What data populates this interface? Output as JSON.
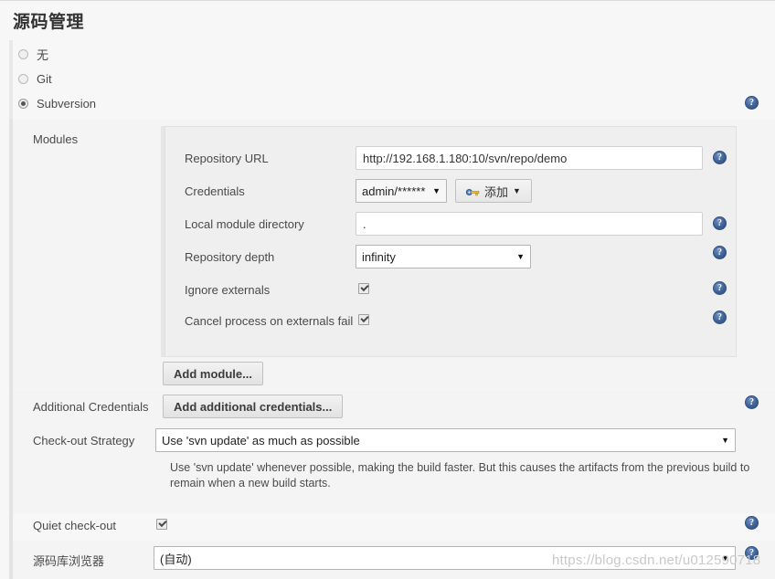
{
  "page": {
    "title": "源码管理",
    "watermark": "https://blog.csdn.net/u012590718"
  },
  "scm_options": [
    {
      "label": "无",
      "selected": false
    },
    {
      "label": "Git",
      "selected": false
    },
    {
      "label": "Subversion",
      "selected": true
    }
  ],
  "modules": {
    "section_label": "Modules",
    "add_module_label": "Add module...",
    "fields": {
      "repository_url": {
        "label": "Repository URL",
        "value": "http://192.168.1.180:10/svn/repo/demo",
        "placeholder": ""
      },
      "credentials": {
        "label": "Credentials",
        "value": "admin/******",
        "add_button_label": "添加"
      },
      "local_module_directory": {
        "label": "Local module directory",
        "value": ".",
        "placeholder": ""
      },
      "repository_depth": {
        "label": "Repository depth",
        "value": "infinity"
      },
      "ignore_externals": {
        "label": "Ignore externals",
        "checked": true
      },
      "cancel_process_on_externals_fail": {
        "label": "Cancel process on externals fail",
        "checked": true
      }
    }
  },
  "additional_credentials": {
    "label": "Additional Credentials",
    "button_label": "Add additional credentials..."
  },
  "checkout_strategy": {
    "label": "Check-out Strategy",
    "value": "Use 'svn update' as much as possible",
    "description": "Use 'svn update' whenever possible, making the build faster. But this causes the artifacts from the previous build to remain when a new build starts."
  },
  "quiet_checkout": {
    "label": "Quiet check-out",
    "checked": true
  },
  "repository_browser": {
    "label": "源码库浏览器",
    "value": "(自动)"
  },
  "icons": {
    "help": "?",
    "caret": "▼",
    "key": "key-icon"
  }
}
